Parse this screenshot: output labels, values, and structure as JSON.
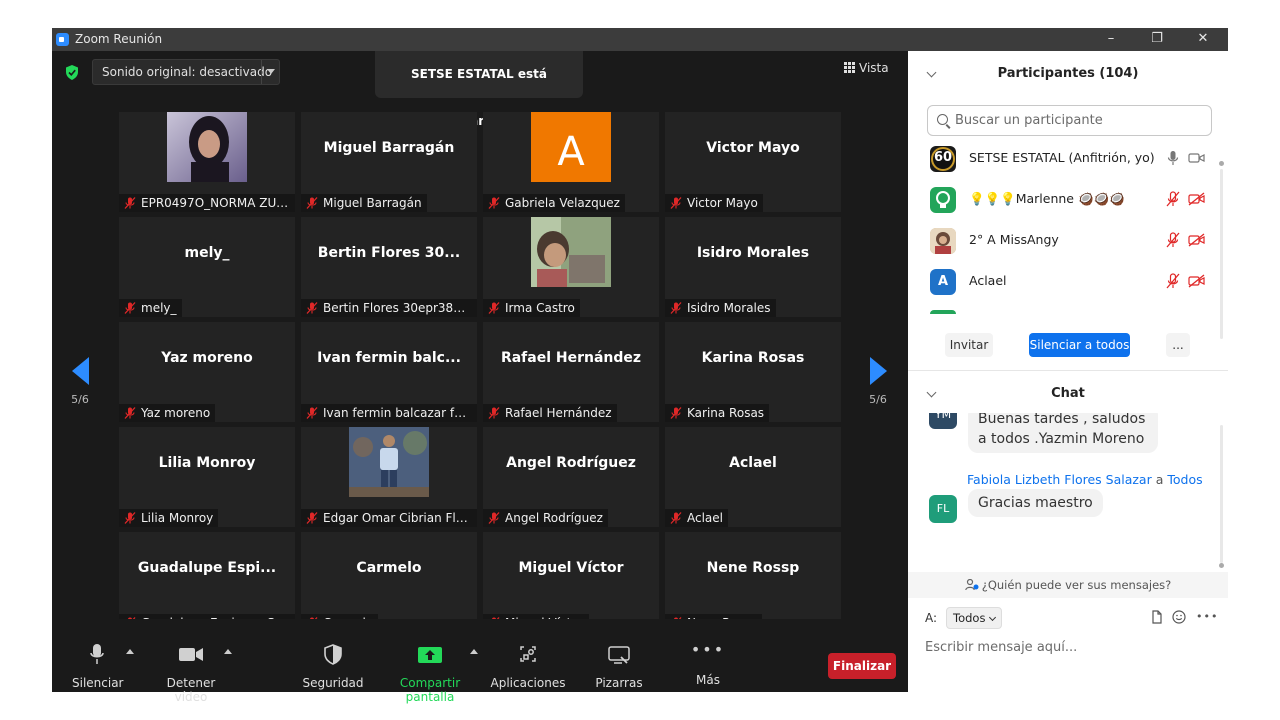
{
  "window": {
    "title": "Zoom Reunión"
  },
  "video": {
    "audio_mode": "Sonido original: desactivado",
    "speaking": "SETSE ESTATAL está hablando...",
    "view_label": "Vista",
    "page_indicator_left": "5/6",
    "page_indicator_right": "5/6",
    "tiles": [
      {
        "big": "",
        "tag": "EPR0497O_NORMA ZUZ...",
        "avatar": "photo-woman"
      },
      {
        "big": "Miguel Barragán",
        "tag": "Miguel Barragán"
      },
      {
        "big": "",
        "tag": "Gabriela Velazquez",
        "avatar_letter": "A"
      },
      {
        "big": "Victor Mayo",
        "tag": "Victor Mayo"
      },
      {
        "big": "mely_",
        "tag": "mely_"
      },
      {
        "big": "Bertin Flores 30...",
        "tag": "Bertin Flores 30epr3807w"
      },
      {
        "big": "",
        "tag": "Irma Castro",
        "avatar": "photo-child"
      },
      {
        "big": "Isidro Morales",
        "tag": "Isidro Morales"
      },
      {
        "big": "Yaz moreno",
        "tag": "Yaz moreno"
      },
      {
        "big": "Ivan fermin balc...",
        "tag": "Ivan fermin balcazar fer..."
      },
      {
        "big": "Rafael Hernández",
        "tag": "Rafael Hernández"
      },
      {
        "big": "Karina Rosas",
        "tag": "Karina Rosas"
      },
      {
        "big": "Lilia Monroy",
        "tag": "Lilia Monroy"
      },
      {
        "big": "",
        "tag": "Edgar Omar Cibrian Flo...",
        "avatar": "photo-man"
      },
      {
        "big": "Angel Rodríguez",
        "tag": "Angel Rodríguez"
      },
      {
        "big": "Aclael",
        "tag": "Aclael"
      },
      {
        "big": "Guadalupe  Espi...",
        "tag": "Guadalupe Espinoza Sá..."
      },
      {
        "big": "Carmelo",
        "tag": "Carmelo"
      },
      {
        "big": "Miguel Víctor",
        "tag": "Miguel Víctor"
      },
      {
        "big": "Nene Rossp",
        "tag": "Nene Rossp"
      }
    ]
  },
  "toolbar": {
    "mute": "Silenciar",
    "stop_video": "Detener vídeo",
    "security": "Seguridad",
    "share_screen": "Compartir pantalla",
    "apps": "Aplicaciones",
    "whiteboards": "Pizarras",
    "more": "Más",
    "end": "Finalizar"
  },
  "participants": {
    "header": "Participantes (104)",
    "search_placeholder": "Buscar un participante",
    "list": [
      {
        "name": "SETSE ESTATAL (Anfitrión, yo)",
        "avatar_text": "60",
        "avatar_color": "#1a1a1a"
      },
      {
        "name": "💡💡💡Marlenne 🥥🥥🥥",
        "avatar_text": "",
        "avatar_color": "#23a55a"
      },
      {
        "name": "2° A  MissAngy",
        "avatar_text": "",
        "avatar_color": "#c9a06a"
      },
      {
        "name": "Aclael",
        "avatar_text": "A",
        "avatar_color": "#1f72c8"
      }
    ],
    "invite": "Invitar",
    "mute_all": "Silenciar a todos",
    "more": "..."
  },
  "chat": {
    "header": "Chat",
    "messages": [
      {
        "avatar": "YM",
        "avatar_color": "#2e4a64",
        "text": "Buenas tardes  , saludos a todos  .Yazmin Moreno"
      },
      {
        "sender": "Fabiola Lizbeth Flores Salazar",
        "to_word": "a",
        "recipient": "Todos",
        "avatar": "FL",
        "avatar_color": "#1f9d7a",
        "text": "Gracias maestro"
      }
    ],
    "who_sees": "¿Quién puede ver sus mensajes?",
    "to_label": "A:",
    "to_value": "Todos",
    "compose_placeholder": "Escribir mensaje aquí..."
  },
  "colors": {
    "accent": "#2d8cff",
    "share_green": "#23d959",
    "end_red": "#c8202a",
    "mute_red": "#e02828",
    "mute_all_blue": "#0e72ed"
  }
}
